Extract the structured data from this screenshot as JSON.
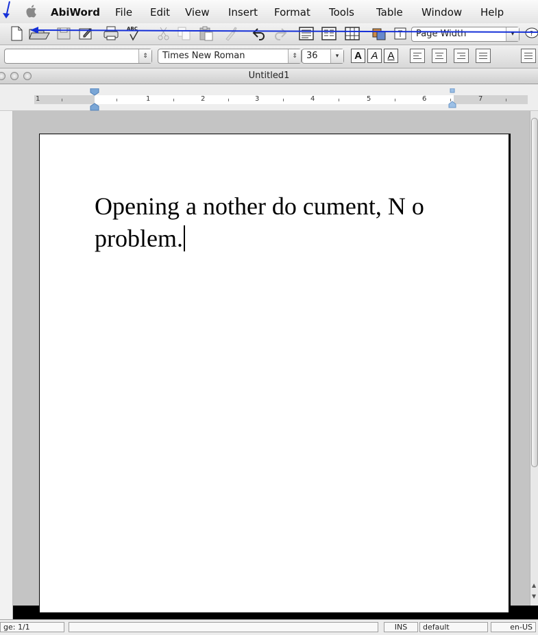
{
  "menubar": {
    "app_name": "AbiWord",
    "items": [
      "File",
      "Edit",
      "View",
      "Insert",
      "Format",
      "Tools",
      "Table",
      "Window",
      "Help"
    ]
  },
  "toolbar_standard": {
    "icons": [
      "new-document-icon",
      "open-document-icon",
      "save-icon",
      "save-as-icon",
      "print-icon",
      "spellcheck-icon",
      "cut-icon",
      "copy-icon",
      "paste-icon",
      "format-painter-icon",
      "undo-icon",
      "redo-icon",
      "align-view-icon",
      "columns-icon",
      "table-icon",
      "insert-image-icon",
      "find-icon"
    ],
    "spellcheck_label": "ABC",
    "zoom_value": "Page Width"
  },
  "toolbar_format": {
    "style_value": "",
    "font_value": "Times New Roman",
    "size_value": "36",
    "bold_label": "A",
    "italic_label": "A",
    "underline_label": "A"
  },
  "window": {
    "title": "Untitled1"
  },
  "ruler": {
    "numbers": [
      "1",
      "1",
      "2",
      "3",
      "4",
      "5",
      "6",
      "7"
    ]
  },
  "document": {
    "text": "Opening a nother do cument, N o problem."
  },
  "statusbar": {
    "page": "ge: 1/1",
    "message": "",
    "mode": "INS",
    "style": "default",
    "language": "en-US"
  },
  "annotation": {
    "arrow_color": "#1530d8"
  }
}
